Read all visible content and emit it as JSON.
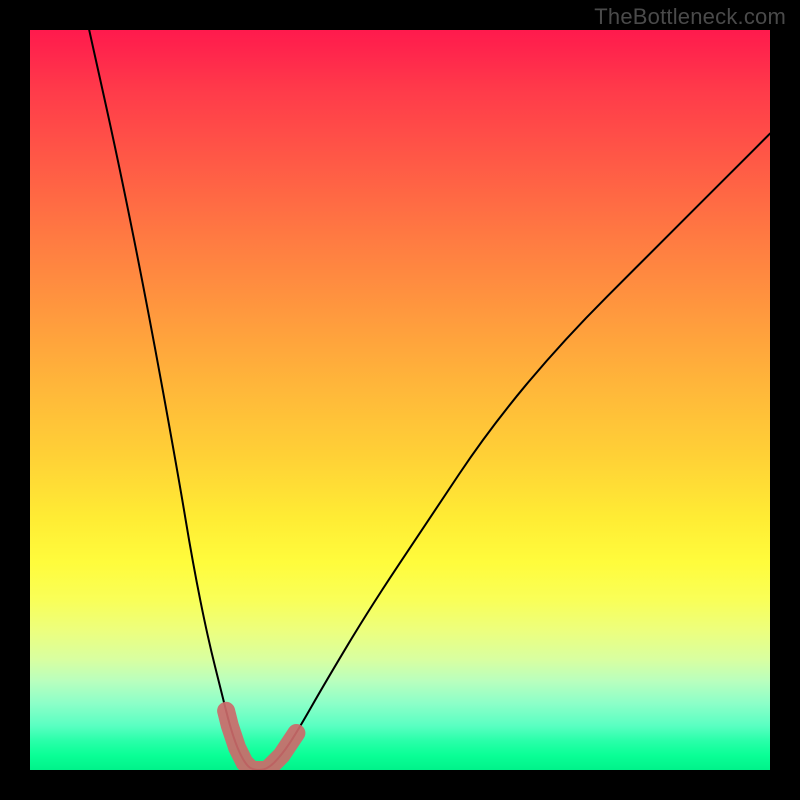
{
  "watermark": "TheBottleneck.com",
  "colors": {
    "frame": "#000000",
    "curve": "#000000",
    "highlight": "#cc6a6a"
  },
  "chart_data": {
    "type": "line",
    "title": "",
    "xlabel": "",
    "ylabel": "",
    "xlim": [
      0,
      100
    ],
    "ylim": [
      0,
      100
    ],
    "grid": false,
    "legend": false,
    "series": [
      {
        "name": "bottleneck-curve",
        "x": [
          8,
          12,
          16,
          20,
          22,
          24,
          26,
          27,
          28,
          29,
          30,
          32,
          34,
          36,
          40,
          46,
          54,
          62,
          72,
          84,
          96,
          100
        ],
        "y": [
          100,
          82,
          62,
          40,
          28,
          18,
          10,
          6,
          3,
          1,
          0,
          0,
          2,
          5,
          12,
          22,
          34,
          46,
          58,
          70,
          82,
          86
        ]
      }
    ],
    "annotations": [
      {
        "name": "optimal-range-highlight",
        "x_range": [
          26.5,
          36
        ],
        "y_range_approx": [
          0,
          10
        ],
        "note": "thick salmon-colored segment near the curve minimum"
      }
    ]
  }
}
